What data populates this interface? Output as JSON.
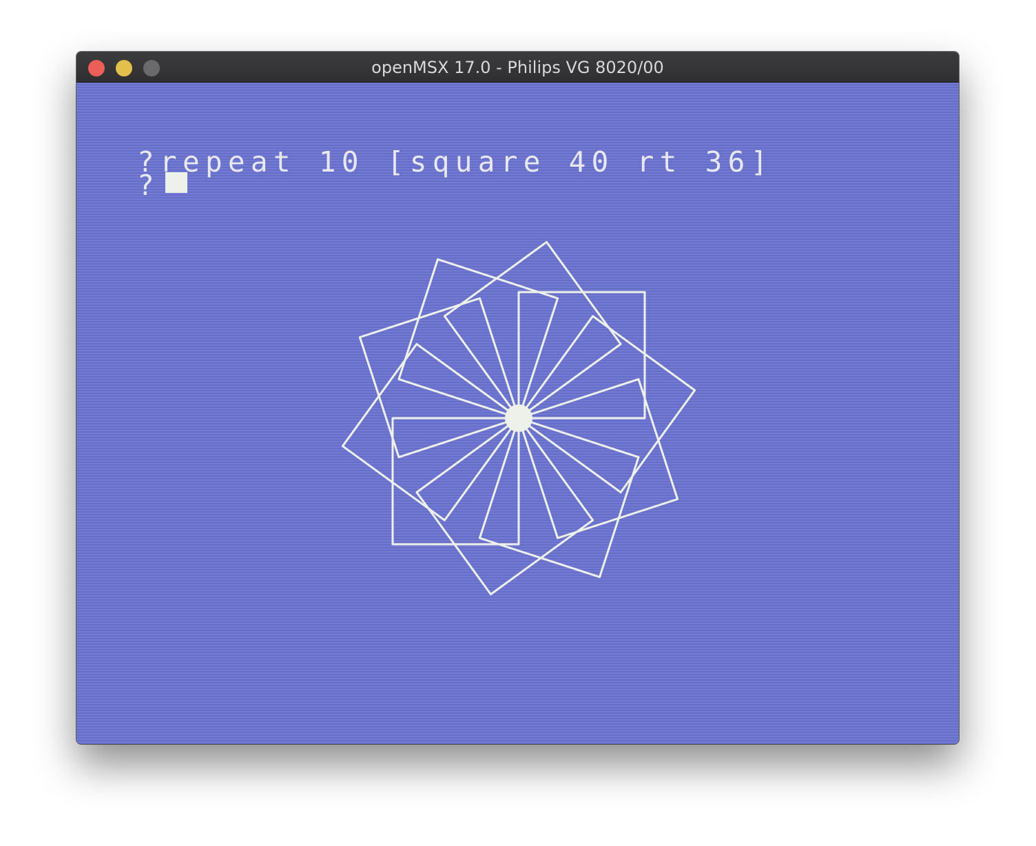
{
  "window": {
    "title": "openMSX 17.0 - Philips VG 8020/00"
  },
  "screen": {
    "command_line": "?repeat 10 [square 40 rt 36]",
    "prompt": "?",
    "background_color": "#6b74d1",
    "foreground_color": "#eef0ea"
  },
  "turtle_drawing": {
    "shape": "square",
    "square_side": 40,
    "repeat_count": 10,
    "turn_degrees": 36
  }
}
